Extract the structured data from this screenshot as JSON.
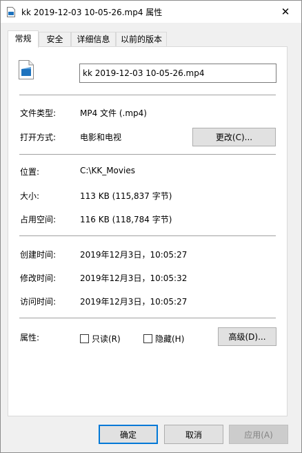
{
  "window": {
    "title": "kk 2019-12-03 10-05-26.mp4 属性",
    "close_glyph": "✕"
  },
  "tabs": [
    {
      "label": "常规",
      "active": true
    },
    {
      "label": "安全",
      "active": false
    },
    {
      "label": "详细信息",
      "active": false
    },
    {
      "label": "以前的版本",
      "active": false
    }
  ],
  "general": {
    "file_name": "kk 2019-12-03 10-05-26.mp4",
    "file_type_label": "文件类型:",
    "file_type_value": "MP4 文件 (.mp4)",
    "opens_with_label": "打开方式:",
    "opens_with_value": "电影和电视",
    "change_button": "更改(C)...",
    "location_label": "位置:",
    "location_value": "C:\\KK_Movies",
    "size_label": "大小:",
    "size_value": "113 KB (115,837 字节)",
    "size_on_disk_label": "占用空间:",
    "size_on_disk_value": "116 KB (118,784 字节)",
    "created_label": "创建时间:",
    "created_value": "2019年12月3日，10:05:27",
    "modified_label": "修改时间:",
    "modified_value": "2019年12月3日，10:05:32",
    "accessed_label": "访问时间:",
    "accessed_value": "2019年12月3日，10:05:27",
    "attributes_label": "属性:",
    "readonly_label": "只读(R)",
    "readonly_checked": false,
    "hidden_label": "隐藏(H)",
    "hidden_checked": false,
    "advanced_button": "高级(D)..."
  },
  "footer": {
    "ok_button": "确定",
    "cancel_button": "取消",
    "apply_button": "应用(A)"
  },
  "colors": {
    "accent": "#0078d7",
    "panel_bg": "#ffffff",
    "window_bg": "#f0f0f0"
  }
}
